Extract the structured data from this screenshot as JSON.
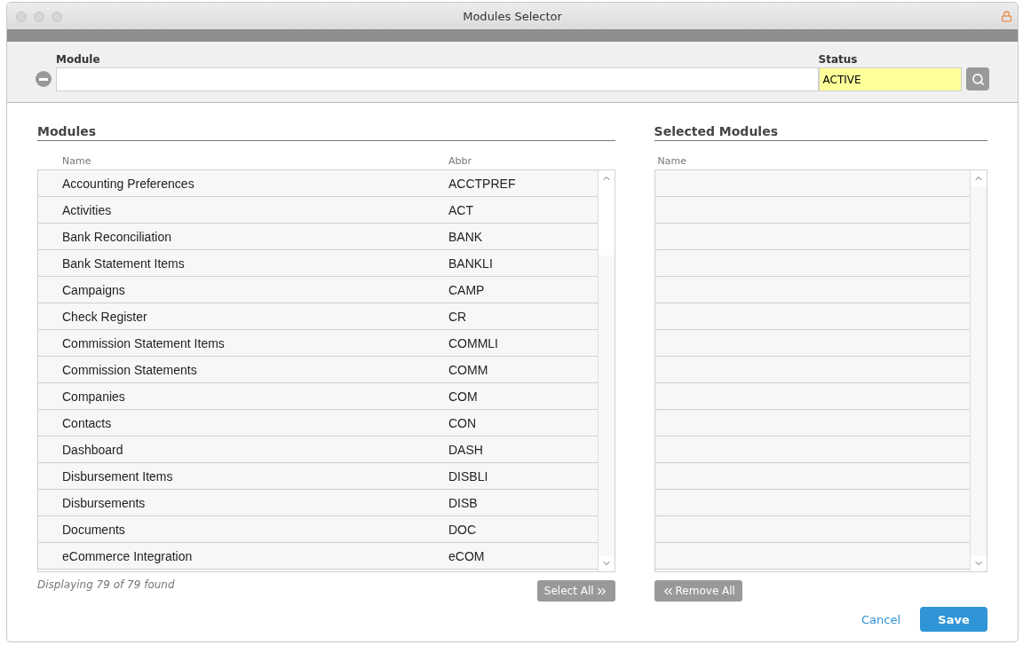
{
  "window": {
    "title": "Modules Selector"
  },
  "filter": {
    "module_label": "Module",
    "status_label": "Status",
    "status_value": "ACTIVE"
  },
  "modules": {
    "title": "Modules",
    "columns": [
      "Name",
      "Abbr"
    ],
    "rows": [
      {
        "name": "Accounting Preferences",
        "abbr": "ACCTPREF"
      },
      {
        "name": "Activities",
        "abbr": "ACT"
      },
      {
        "name": "Bank Reconciliation",
        "abbr": "BANK"
      },
      {
        "name": "Bank Statement Items",
        "abbr": "BANKLI"
      },
      {
        "name": "Campaigns",
        "abbr": "CAMP"
      },
      {
        "name": "Check Register",
        "abbr": "CR"
      },
      {
        "name": "Commission Statement Items",
        "abbr": "COMMLI"
      },
      {
        "name": "Commission Statements",
        "abbr": "COMM"
      },
      {
        "name": "Companies",
        "abbr": "COM"
      },
      {
        "name": "Contacts",
        "abbr": "CON"
      },
      {
        "name": "Dashboard",
        "abbr": "DASH"
      },
      {
        "name": "Disbursement Items",
        "abbr": "DISBLI"
      },
      {
        "name": "Disbursements",
        "abbr": "DISB"
      },
      {
        "name": "Documents",
        "abbr": "DOC"
      },
      {
        "name": "eCommerce Integration",
        "abbr": "eCOM"
      }
    ],
    "footer": "Displaying 79 of 79 found",
    "select_all": "Select All"
  },
  "selected_modules": {
    "title": "Selected Modules",
    "columns": [
      "Name"
    ],
    "remove_all": "Remove All"
  },
  "buttons": {
    "cancel": "Cancel",
    "save": "Save"
  }
}
